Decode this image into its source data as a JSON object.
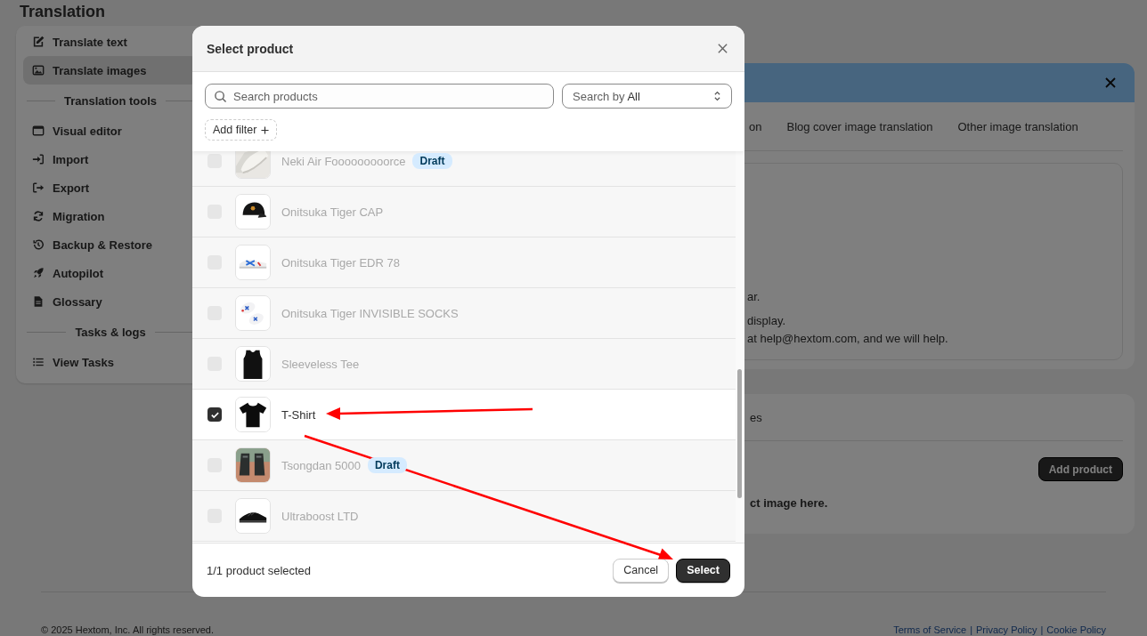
{
  "page_title": "Translation",
  "sidebar": {
    "items": [
      {
        "kind": "item",
        "label": "Translate text",
        "selected": false
      },
      {
        "kind": "item",
        "label": "Translate images",
        "selected": true
      },
      {
        "kind": "section",
        "label": "Translation tools"
      },
      {
        "kind": "item",
        "label": "Visual editor",
        "selected": false
      },
      {
        "kind": "item",
        "label": "Import",
        "selected": false
      },
      {
        "kind": "item",
        "label": "Export",
        "selected": false
      },
      {
        "kind": "item",
        "label": "Migration",
        "selected": false
      },
      {
        "kind": "item",
        "label": "Backup & Restore",
        "selected": false
      },
      {
        "kind": "item",
        "label": "Autopilot",
        "selected": false
      },
      {
        "kind": "item",
        "label": "Glossary",
        "selected": false
      },
      {
        "kind": "section",
        "label": "Tasks & logs"
      },
      {
        "kind": "item",
        "label": "View Tasks",
        "selected": false
      }
    ]
  },
  "main": {
    "tabs": [
      {
        "label": "on",
        "selected": false
      },
      {
        "label": "Blog cover image translation",
        "selected": false
      },
      {
        "label": "Other image translation",
        "selected": false
      }
    ],
    "info_lines": [
      "ar.",
      "display.",
      "at help@hextom.com, and we will help."
    ],
    "products_card": {
      "heading": "es",
      "add_button": "Add product",
      "empty_text": "ct image here."
    }
  },
  "modal": {
    "title": "Select product",
    "search": {
      "placeholder": "Search products"
    },
    "search_by": {
      "label": "Search by",
      "value": "All"
    },
    "add_filter": "Add filter",
    "products": [
      {
        "name": "Neki Air Fooooooooorce",
        "badge": "Draft",
        "selected": false
      },
      {
        "name": "Onitsuka Tiger CAP",
        "selected": false
      },
      {
        "name": "Onitsuka Tiger EDR 78",
        "selected": false
      },
      {
        "name": "Onitsuka Tiger INVISIBLE SOCKS",
        "selected": false
      },
      {
        "name": "Sleeveless Tee",
        "selected": false
      },
      {
        "name": "T-Shirt",
        "selected": true
      },
      {
        "name": "Tsongdan 5000",
        "badge": "Draft",
        "selected": false
      },
      {
        "name": "Ultraboost LTD",
        "selected": false
      }
    ],
    "selection_count": "1/1 product selected",
    "buttons": [
      "Cancel",
      "Select"
    ]
  },
  "footer": {
    "copyright": "© 2025 Hextom, Inc. All rights reserved.",
    "links": [
      "Terms of Service",
      "Privacy Policy",
      "Cookie Policy"
    ],
    "separator": "|"
  }
}
